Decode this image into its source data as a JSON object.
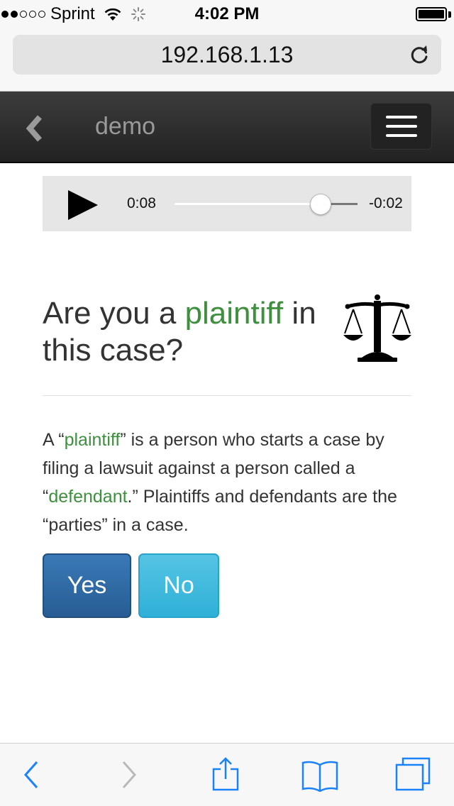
{
  "status_bar": {
    "carrier": "Sprint",
    "time": "4:02 PM",
    "signal_icon": "signal-dots-icon",
    "wifi_icon": "wifi-icon",
    "activity_icon": "activity-spinner-icon",
    "battery_icon": "battery-icon"
  },
  "browser": {
    "url": "192.168.1.13",
    "reload_icon": "reload-icon"
  },
  "navbar": {
    "title": "demo",
    "back_icon": "chevron-left-icon",
    "menu_icon": "hamburger-menu-icon"
  },
  "audio": {
    "play_icon": "play-icon",
    "elapsed": "0:08",
    "remaining": "-0:02",
    "progress": 0.8
  },
  "question": {
    "prefix": "Are you a ",
    "highlight": "plaintiff",
    "suffix": " in this case?",
    "icon": "scales-of-justice-icon"
  },
  "paragraph": {
    "t1": "A “",
    "term1": "plaintiff",
    "t2": "” is a person who starts a case by filing a lawsuit against a person called a “",
    "term2": "defendant",
    "t3": ".” Plaintiffs and defendants are the “parties” in a case."
  },
  "buttons": {
    "yes": "Yes",
    "no": "No"
  },
  "toolbar": {
    "back_icon": "back-arrow-icon",
    "forward_icon": "forward-arrow-icon",
    "share_icon": "share-icon",
    "bookmarks_icon": "bookmarks-icon",
    "tabs_icon": "tabs-icon"
  },
  "colors": {
    "accent_green": "#3e8f3e",
    "primary_button": "#2d6ca7",
    "info_button": "#3bb8dd",
    "navbar": "#2a2a2a",
    "safari_blue": "#1a82fb"
  }
}
